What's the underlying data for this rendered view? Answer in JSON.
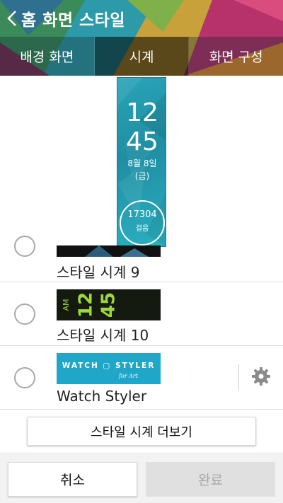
{
  "header": {
    "title": "홈 화면 스타일",
    "tabs": [
      {
        "label": "배경 화면",
        "selected": false
      },
      {
        "label": "시계",
        "selected": true
      },
      {
        "label": "화면 구성",
        "selected": false
      }
    ]
  },
  "preview": {
    "hour": "12",
    "minute": "45",
    "date": "8월 8일",
    "day": "(금)",
    "steps": "17304",
    "steps_label": "걸음"
  },
  "styles": [
    {
      "label": "스타일 시계 9",
      "selected": false
    },
    {
      "label": "스타일 시계 10",
      "selected": false,
      "thumb_am": "AM",
      "thumb_hour": "12",
      "thumb_min": "45"
    },
    {
      "label": "Watch Styler",
      "selected": false,
      "thumb_text": "WATCH ▢ STYLER",
      "thumb_sub": "for Art",
      "settings_icon": "gear-icon"
    }
  ],
  "more_button": "스타일 시계 더보기",
  "footer": {
    "cancel": "취소",
    "done": "완료",
    "done_enabled": false
  },
  "colors": {
    "accent": "#1fa6c9",
    "preview_bg": "#2aa3b8",
    "neon_green": "#9fd83a"
  }
}
